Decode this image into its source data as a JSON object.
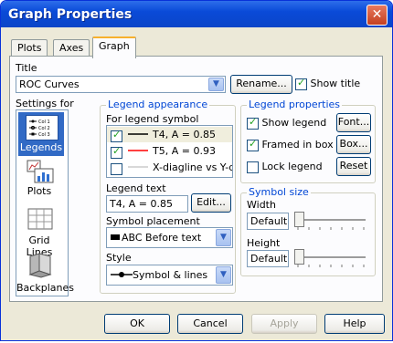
{
  "window": {
    "title": "Graph Properties"
  },
  "tabs": [
    {
      "label": "Plots"
    },
    {
      "label": "Axes"
    },
    {
      "label": "Graph",
      "active": true
    }
  ],
  "title_section": {
    "label": "Title",
    "value": "ROC Curves",
    "rename_label": "Rename...",
    "show_title_label": "Show title",
    "show_title_checked": true
  },
  "settings_for": {
    "label": "Settings for",
    "items": [
      {
        "label": "Legends",
        "icon": "legend-icon",
        "selected": true
      },
      {
        "label": "Plots",
        "icon": "plots-icon"
      },
      {
        "label": "Grid Lines",
        "icon": "grid-lines-icon"
      },
      {
        "label": "Backplanes",
        "icon": "backplanes-icon"
      }
    ],
    "legend_icon_text": [
      "Col 1",
      "Col 2",
      "Col 3"
    ]
  },
  "legend_appearance": {
    "label": "Legend appearance",
    "for_symbol_label": "For legend symbol",
    "symbols": [
      {
        "label": "T4, A = 0.85",
        "checked": true,
        "color": "#000000"
      },
      {
        "label": "T5, A = 0.93",
        "checked": true,
        "color": "#ff0000"
      },
      {
        "label": "X-diagline vs Y-d",
        "checked": false,
        "color": "#a0a0a0"
      }
    ],
    "legend_text_label": "Legend text",
    "legend_text_value": "T4, A = 0.85",
    "edit_label": "Edit...",
    "symbol_placement_label": "Symbol placement",
    "symbol_placement_value": "ABC Before text",
    "style_label": "Style",
    "style_value": "Symbol & lines"
  },
  "legend_properties": {
    "label": "Legend properties",
    "show_legend_label": "Show legend",
    "show_legend_checked": true,
    "framed_label": "Framed in box",
    "framed_checked": true,
    "lock_label": "Lock legend",
    "lock_checked": false,
    "font_label": "Font...",
    "box_label": "Box...",
    "reset_label": "Reset"
  },
  "symbol_size": {
    "label": "Symbol size",
    "width_label": "Width",
    "width_value": "Default",
    "height_label": "Height",
    "height_value": "Default"
  },
  "footer": {
    "ok": "OK",
    "cancel": "Cancel",
    "apply": "Apply",
    "help": "Help"
  },
  "colors": {
    "title_bar": "#0a4ad8",
    "accent_tab": "#f7b02d",
    "group_label": "#0046d5",
    "selected_item": "#316ac5"
  }
}
